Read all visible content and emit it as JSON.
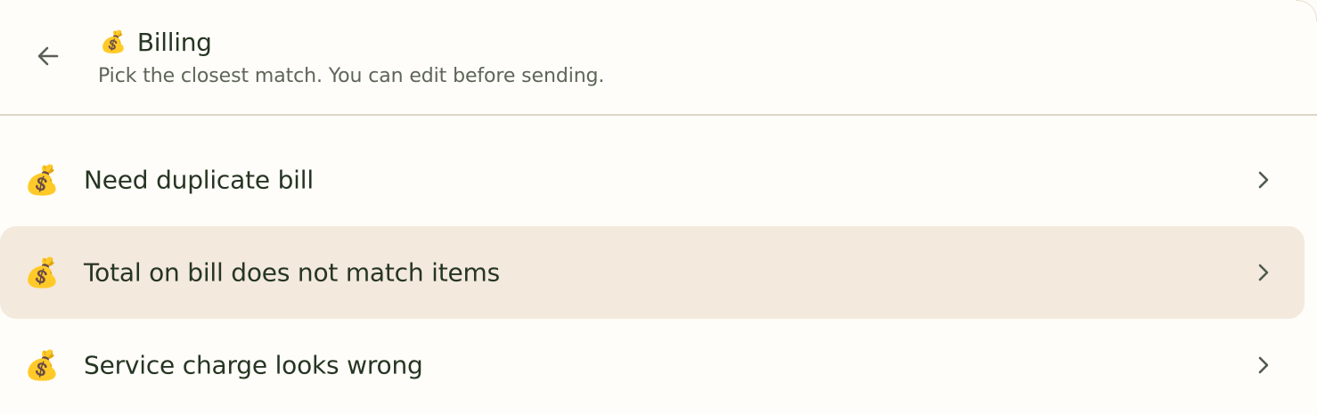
{
  "header": {
    "emoji": "💰",
    "title": "Billing",
    "subtitle": "Pick the closest match. You can edit before sending."
  },
  "items": [
    {
      "emoji": "💰",
      "label": "Need duplicate bill",
      "highlighted": false
    },
    {
      "emoji": "💰",
      "label": "Total on bill does not match items",
      "highlighted": true
    },
    {
      "emoji": "💰",
      "label": "Service charge looks wrong",
      "highlighted": false
    }
  ],
  "colors": {
    "background": "#fefdf9",
    "highlight": "#f3e9dd",
    "text": "#263523",
    "subtext": "#5e6558",
    "divider": "#ddd5c6"
  },
  "icons": {
    "back": "arrow-left-icon",
    "chevron": "chevron-right-icon",
    "item": "money-bag-icon"
  }
}
